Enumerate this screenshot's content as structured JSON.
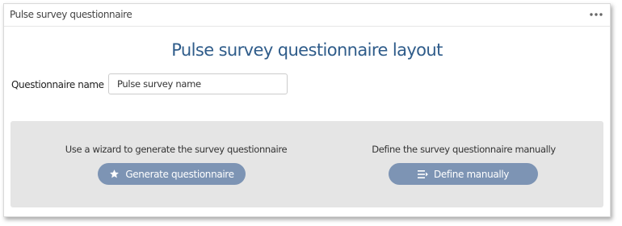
{
  "panel": {
    "title": "Pulse survey questionnaire",
    "menu_icon": "more-horizontal-icon"
  },
  "main": {
    "title": "Pulse survey questionnaire layout",
    "name_label": "Questionnaire name",
    "name_value": "Pulse survey name"
  },
  "options": {
    "wizard": {
      "text": "Use a wizard to generate the survey questionnaire",
      "button_label": "Generate questionnaire",
      "button_icon": "star-icon"
    },
    "manual": {
      "text": "Define the survey questionnaire manually",
      "button_label": "Define manually",
      "button_icon": "list-indent-icon"
    }
  },
  "colors": {
    "title": "#2f5c8a",
    "button": "#7d94b4",
    "options_background": "#e5e5e5"
  }
}
